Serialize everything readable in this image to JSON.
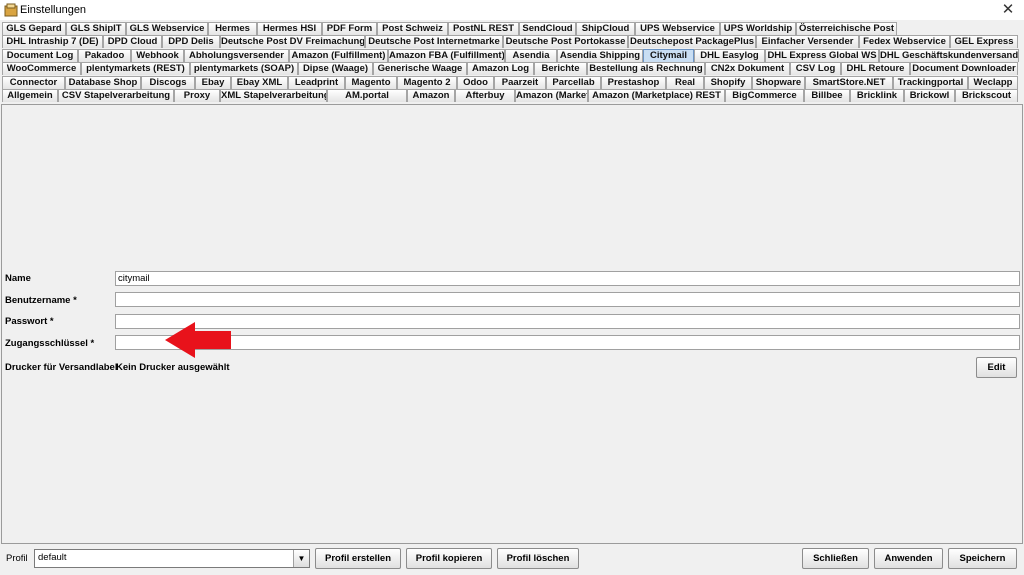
{
  "window": {
    "title": "Einstellungen",
    "close": "✕"
  },
  "tabs": [
    [
      "GLS Gepard",
      "GLS ShipIT",
      "GLS Webservice",
      "Hermes",
      "Hermes HSI",
      "PDF Form",
      "Post Schweiz",
      "PostNL REST",
      "SendCloud",
      "ShipCloud",
      "UPS Webservice",
      "UPS Worldship",
      "Österreichische Post"
    ],
    [
      "DHL Intraship 7 (DE)",
      "DPD Cloud",
      "DPD Delis",
      "Deutsche Post DV Freimachung",
      "Deutsche Post Internetmarke",
      "Deutsche Post Portokasse",
      "Deutschepost PackagePlus",
      "Einfacher Versender",
      "Fedex Webservice",
      "GEL Express"
    ],
    [
      "Document Log",
      "Pakadoo",
      "Webhook",
      "Abholungsversender",
      "Amazon (Fulfillment)",
      "Amazon FBA (Fulfillment)",
      "Asendia",
      "Asendia Shipping",
      "Citymail",
      "DHL Easylog",
      "DHL Express Global WS",
      "DHL Geschäftskundenversand"
    ],
    [
      "WooCommerce",
      "plentymarkets (REST)",
      "plentymarkets (SOAP)",
      "Dipse (Waage)",
      "Generische Waage",
      "Amazon Log",
      "Berichte",
      "Bestellung als Rechnung",
      "CN2x Dokument",
      "CSV Log",
      "DHL Retoure",
      "Document Downloader"
    ],
    [
      "Connector",
      "Database Shop",
      "Discogs",
      "Ebay",
      "Ebay XML",
      "Leadprint",
      "Magento",
      "Magento 2",
      "Odoo",
      "Paarzeit",
      "Parcellab",
      "Prestashop",
      "Real",
      "Shopify",
      "Shopware",
      "SmartStore.NET",
      "Trackingportal",
      "Weclapp"
    ],
    [
      "Allgemein",
      "CSV Stapelverarbeitung",
      "Proxy",
      "XML Stapelverarbeitung",
      "AM.portal",
      "Amazon",
      "Afterbuy",
      "Amazon (Marketplace)",
      "Amazon (Marketplace) REST",
      "BigCommerce",
      "Billbee",
      "Bricklink",
      "Brickowl",
      "Brickscout"
    ]
  ],
  "selected_tab": "Citymail",
  "form": {
    "name_label": "Name",
    "name_value": "citymail",
    "user_label": "Benutzername *",
    "user_value": "",
    "password_label": "Passwort *",
    "password_value": "",
    "key_label": "Zugangsschlüssel *",
    "key_value": "",
    "printer_label": "Drucker für Versandlabel",
    "printer_value": "Kein Drucker ausgewählt",
    "edit_button": "Edit"
  },
  "annotation": {
    "arrow_color": "#e8121b"
  },
  "footer": {
    "profile_label": "Profil",
    "profile_value": "default",
    "create": "Profil erstellen",
    "copy": "Profil kopieren",
    "delete": "Profil löschen",
    "close": "Schließen",
    "apply": "Anwenden",
    "save": "Speichern"
  }
}
